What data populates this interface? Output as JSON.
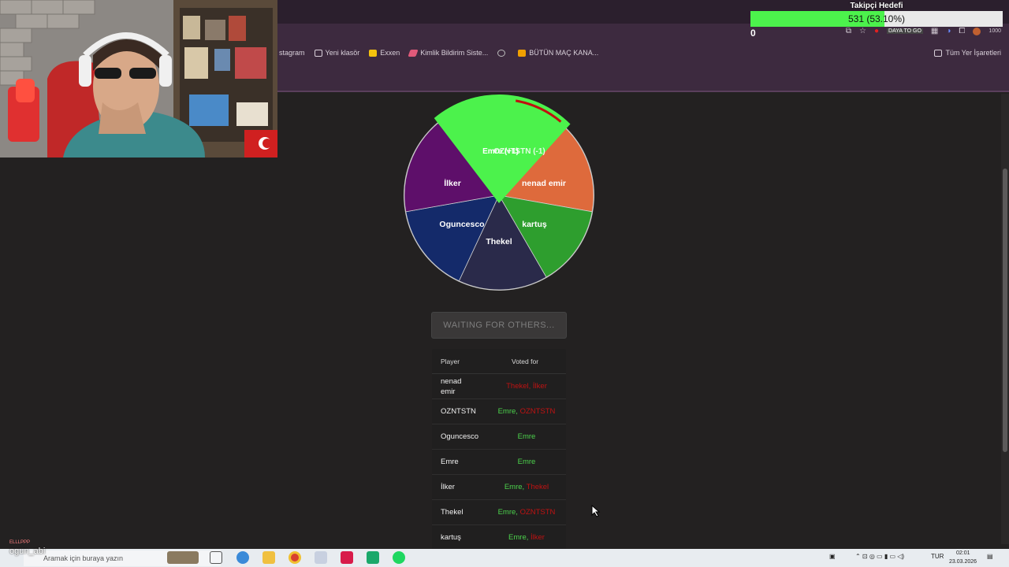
{
  "browser": {
    "bookmarks": [
      {
        "label": "stagram",
        "icon": "instagram-icon",
        "color": "#c0508a"
      },
      {
        "label": "Yeni klasör",
        "icon": "folder-icon",
        "color": "#d9d0da"
      },
      {
        "label": "Exxen",
        "icon": "exxen-icon",
        "color": "#f4c20d"
      },
      {
        "label": "Kimlik Bildirim Siste...",
        "icon": "link-icon",
        "color": "#e05a7a"
      },
      {
        "label": "",
        "icon": "globe-icon",
        "color": "#bbbbbb"
      },
      {
        "label": "BÜTÜN MAÇ KANA...",
        "icon": "jp-icon",
        "color": "#f0a000"
      }
    ],
    "all_bookmarks": "Tüm Yer İşaretleri",
    "toolbar_text": "DAYA TO GO",
    "toolbar_count": "1000"
  },
  "goal": {
    "title": "Takipçi Hedefi",
    "text": "531 (53.10%)",
    "fraction": 0.531,
    "zero": "0"
  },
  "wheel": {
    "slices": [
      {
        "label": "Emre (+1)",
        "overlay": "OZNTSTN (-1)",
        "color": "#4cf24c",
        "from": -40,
        "to": 45
      },
      {
        "label": "nenad emir",
        "color": "#de6a3c",
        "from": 45,
        "to": 100
      },
      {
        "label": "kartuş",
        "color": "#2e9e2e",
        "from": 100,
        "to": 150
      },
      {
        "label": "Thekel",
        "color": "#2a2a4a",
        "from": 150,
        "to": 205
      },
      {
        "label": "Oguncesco",
        "color": "#142a6a",
        "from": 205,
        "to": 260
      },
      {
        "label": "İlker",
        "color": "#5e0f6a",
        "from": 260,
        "to": 320
      }
    ]
  },
  "waiting_label": "WAITING FOR OTHERS...",
  "table": {
    "headers": [
      "Player",
      "Voted for"
    ],
    "rows": [
      {
        "player": "nenad emir",
        "votes": [
          {
            "text": "Thekel, İlker",
            "color": "red"
          }
        ]
      },
      {
        "player": "OZNTSTN",
        "votes": [
          {
            "text": "Emre",
            "color": "green"
          },
          {
            "text": "OZNTSTN",
            "color": "red"
          }
        ]
      },
      {
        "player": "Oguncesco",
        "votes": [
          {
            "text": "Emre",
            "color": "green"
          }
        ]
      },
      {
        "player": "Emre",
        "votes": [
          {
            "text": "Emre",
            "color": "green"
          }
        ]
      },
      {
        "player": "İlker",
        "votes": [
          {
            "text": "Emre",
            "color": "green"
          },
          {
            "text": "Thekel",
            "color": "red"
          }
        ]
      },
      {
        "player": "Thekel",
        "votes": [
          {
            "text": "Emre",
            "color": "green"
          },
          {
            "text": "OZNTSTN",
            "color": "red"
          }
        ]
      },
      {
        "player": "kartuş",
        "votes": [
          {
            "text": "Emre",
            "color": "green"
          },
          {
            "text": "İlker",
            "color": "red"
          }
        ]
      }
    ]
  },
  "chat": {
    "mini": "ELLLPPP",
    "name": "ogun_abi"
  },
  "taskbar": {
    "search_placeholder": "Aramak için buraya yazın",
    "lang": "TUR",
    "time": "02:01",
    "date": "23.03.2026"
  }
}
